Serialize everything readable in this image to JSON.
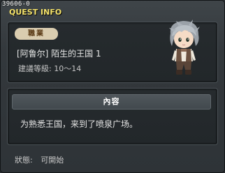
{
  "window": {
    "quest_id": "39606-0",
    "title": "QUEST INFO"
  },
  "quest": {
    "job_badge": "職業",
    "name": "[阿鲁尔] 陌生的王国 1",
    "level_label": "建議等級:",
    "level_range": "10～14"
  },
  "npc": {
    "icon": "npc-character-portrait"
  },
  "content": {
    "header": "內容",
    "text": "为熟悉王国，来到了喷泉广场。"
  },
  "status": {
    "label": "狀態:",
    "value": "可開始"
  },
  "colors": {
    "title": "#f5e36a",
    "badge_bg": "#dacdb0",
    "badge_text": "#5b3b16",
    "panel_bg": "#262b2e"
  }
}
